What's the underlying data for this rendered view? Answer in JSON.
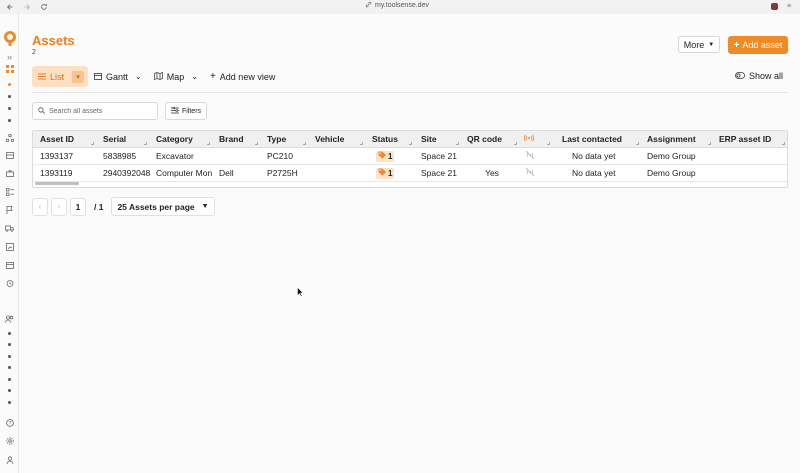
{
  "browser": {
    "url": "my.toolsense.dev"
  },
  "page": {
    "title": "Assets",
    "count": "2"
  },
  "header": {
    "more_label": "More",
    "add_label": "Add asset"
  },
  "views": {
    "list": "List",
    "gantt": "Gantt",
    "map": "Map",
    "add_view": "Add new view",
    "show_all": "Show all"
  },
  "toolbar": {
    "search_placeholder": "Search all assets",
    "filters_label": "Filters"
  },
  "table": {
    "columns": [
      "Asset ID",
      "Serial",
      "Category",
      "Brand",
      "Type",
      "Vehicle",
      "Status",
      "Site",
      "QR code",
      "",
      "Last contacted",
      "Assignment",
      "ERP asset ID"
    ],
    "rows": [
      {
        "asset_id": "1393137",
        "serial": "5838985",
        "category": "Excavator",
        "brand": "",
        "type": "PC210",
        "vehicle": "",
        "status_count": "1",
        "site": "Space 21",
        "qr_code": "",
        "last_contacted": "No data yet",
        "assignment": "Demo Group",
        "erp_asset_id": ""
      },
      {
        "asset_id": "1393119",
        "serial": "2940392048",
        "category": "Computer Mon",
        "brand": "Dell",
        "type": "P2725H",
        "vehicle": "",
        "status_count": "1",
        "site": "Space 21",
        "qr_code": "Yes",
        "last_contacted": "No data yet",
        "assignment": "Demo Group",
        "erp_asset_id": ""
      }
    ]
  },
  "pagination": {
    "current_page": "1",
    "total": "/ 1",
    "per_page": "25 Assets per page"
  },
  "colors": {
    "accent": "#f08a24",
    "title": "#f07d16",
    "status_bg": "#fbe3c8"
  },
  "icons": [
    "back-icon",
    "forward-icon",
    "reload-icon",
    "link-icon",
    "logo-icon",
    "list-icon",
    "calendar-icon",
    "map-icon",
    "plus-icon",
    "eye-icon",
    "search-icon",
    "filter-icon",
    "signal-icon",
    "tag-icon",
    "chevron-left-icon",
    "chevron-right-icon",
    "caret-down-icon"
  ]
}
